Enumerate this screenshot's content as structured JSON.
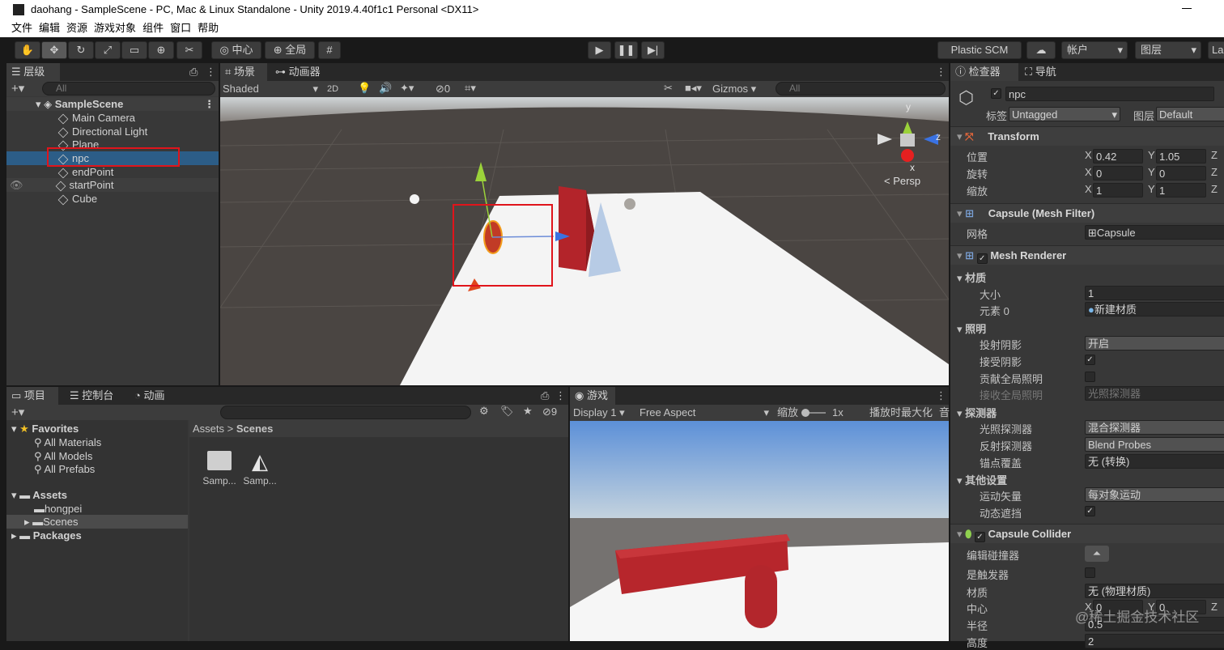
{
  "window": {
    "title": "daohang - SampleScene - PC, Mac & Linux Standalone - Unity 2019.4.40f1c1 Personal <DX11>"
  },
  "menu": [
    "文件",
    "编辑",
    "资源",
    "游戏对象",
    "组件",
    "窗口",
    "帮助"
  ],
  "toolbar": {
    "pivot": "中心",
    "global": "全局",
    "plastic": "Plastic SCM",
    "account": "帐户",
    "layers": "图层",
    "layout": "La"
  },
  "hierarchy": {
    "tab": "层级",
    "search_placeholder": "All",
    "scene": "SampleScene",
    "items": [
      "Main Camera",
      "Directional Light",
      "Plane",
      "npc",
      "endPoint",
      "startPoint",
      "Cube"
    ],
    "selected": "npc"
  },
  "scene_view": {
    "tab_scene": "场景",
    "tab_animator": "动画器",
    "shading": "Shaded",
    "mode_2d": "2D",
    "hidden_count": "0",
    "gizmos": "Gizmos",
    "search_placeholder": "All",
    "persp": "< Persp",
    "axis_x": "x",
    "axis_y": "y",
    "axis_z": "z"
  },
  "project": {
    "tab_project": "项目",
    "tab_console": "控制台",
    "tab_animation": "动画",
    "hidden_count": "9",
    "favorites_title": "Favorites",
    "favorites": [
      "All Materials",
      "All Models",
      "All Prefabs"
    ],
    "assets_title": "Assets",
    "asset_folders": [
      "hongpei",
      "Scenes"
    ],
    "packages": "Packages",
    "breadcrumb_root": "Assets",
    "breadcrumb_sep": ">",
    "breadcrumb_current": "Scenes",
    "files": [
      "Samp...",
      "Samp..."
    ]
  },
  "game_view": {
    "tab": "游戏",
    "display": "Display 1",
    "aspect": "Free Aspect",
    "scale_label": "缩放",
    "scale_value": "1x",
    "maximize": "播放时最大化",
    "mute": "音"
  },
  "inspector": {
    "tab": "检查器",
    "tab_nav": "导航",
    "object_name": "npc",
    "tag_label": "标签",
    "tag_value": "Untagged",
    "layer_label": "图层",
    "layer_value": "Default",
    "transform": {
      "title": "Transform",
      "rows": [
        {
          "label": "位置",
          "x": "0.42",
          "y": "1.05",
          "z": "Z"
        },
        {
          "label": "旋转",
          "x": "0",
          "y": "0",
          "z": "Z"
        },
        {
          "label": "缩放",
          "x": "1",
          "y": "1",
          "z": "Z"
        }
      ]
    },
    "mesh_filter": {
      "title": "Capsule (Mesh Filter)",
      "mesh_label": "网格",
      "mesh_value": "Capsule"
    },
    "mesh_renderer": {
      "title": "Mesh Renderer",
      "materials_title": "材质",
      "size_label": "大小",
      "size_value": "1",
      "element_label": "元素 0",
      "element_value": "新建材质",
      "lighting_title": "照明",
      "cast_label": "投射阴影",
      "cast_value": "开启",
      "receive_label": "接受阴影",
      "gi_contrib_label": "贡献全局照明",
      "gi_receive_label": "接收全局照明",
      "gi_receive_value": "光照探测器",
      "probes_title": "探测器",
      "light_probes_label": "光照探测器",
      "light_probes_value": "混合探测器",
      "refl_probes_label": "反射探测器",
      "refl_probes_value": "Blend Probes",
      "anchor_label": "锚点覆盖",
      "anchor_value": "无 (转换)",
      "other_title": "其他设置",
      "motion_label": "运动矢量",
      "motion_value": "每对象运动",
      "dyn_occ_label": "动态遮挡"
    },
    "capsule_collider": {
      "title": "Capsule Collider",
      "edit_label": "编辑碰撞器",
      "trigger_label": "是触发器",
      "material_label": "材质",
      "material_value": "无 (物理材质)",
      "center_label": "中心",
      "center_x": "0",
      "center_y": "0",
      "center_z": "Z",
      "radius_label": "半径",
      "radius_value": "0.5",
      "height_label": "高度",
      "height_value": "2"
    }
  },
  "watermark": "@稀土掘金技术社区"
}
